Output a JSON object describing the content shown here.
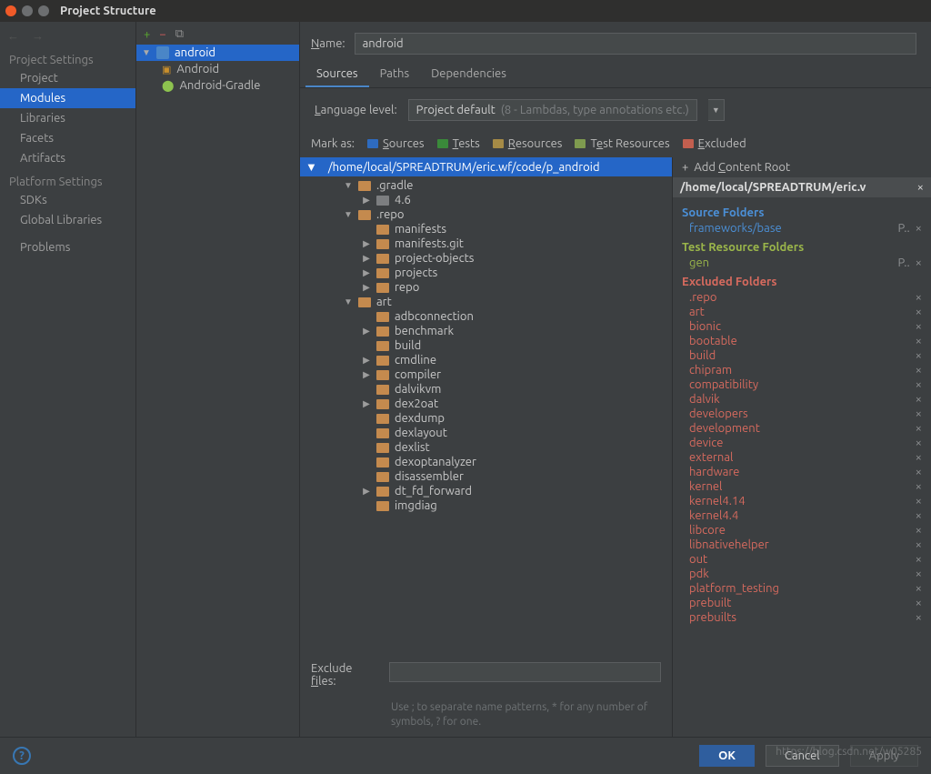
{
  "window": {
    "title": "Project Structure"
  },
  "sidebar": {
    "section1": "Project Settings",
    "items1": [
      "Project",
      "Modules",
      "Libraries",
      "Facets",
      "Artifacts"
    ],
    "section2": "Platform Settings",
    "items2": [
      "SDKs",
      "Global Libraries"
    ],
    "section3": "",
    "items3": [
      "Problems"
    ],
    "selected": "Modules"
  },
  "modules": {
    "root": "android",
    "children": [
      "Android",
      "Android-Gradle"
    ]
  },
  "panel": {
    "name_label": "Name:",
    "name_value": "android",
    "tabs": [
      "Sources",
      "Paths",
      "Dependencies"
    ],
    "active_tab": "Sources",
    "lang_label": "Language level:",
    "lang_value": "Project default",
    "lang_hint": "(8 - Lambdas, type annotations etc.)",
    "mark_label": "Mark as:",
    "marks": [
      "Sources",
      "Tests",
      "Resources",
      "Test Resources",
      "Excluded"
    ]
  },
  "tree": {
    "header": "/home/local/SPREADTRUM/eric.wf/code/p_android",
    "nodes": [
      {
        "d": 1,
        "t": "down",
        "c": "orange",
        "n": ".gradle"
      },
      {
        "d": 2,
        "t": "right",
        "c": "grey",
        "n": "4.6"
      },
      {
        "d": 1,
        "t": "down",
        "c": "orange",
        "n": ".repo"
      },
      {
        "d": 2,
        "t": "none",
        "c": "orange",
        "n": "manifests"
      },
      {
        "d": 2,
        "t": "right",
        "c": "orange",
        "n": "manifests.git"
      },
      {
        "d": 2,
        "t": "right",
        "c": "orange",
        "n": "project-objects"
      },
      {
        "d": 2,
        "t": "right",
        "c": "orange",
        "n": "projects"
      },
      {
        "d": 2,
        "t": "right",
        "c": "orange",
        "n": "repo"
      },
      {
        "d": 1,
        "t": "down",
        "c": "orange",
        "n": "art"
      },
      {
        "d": 2,
        "t": "none",
        "c": "orange",
        "n": "adbconnection"
      },
      {
        "d": 2,
        "t": "right",
        "c": "orange",
        "n": "benchmark"
      },
      {
        "d": 2,
        "t": "none",
        "c": "orange",
        "n": "build"
      },
      {
        "d": 2,
        "t": "right",
        "c": "orange",
        "n": "cmdline"
      },
      {
        "d": 2,
        "t": "right",
        "c": "orange",
        "n": "compiler"
      },
      {
        "d": 2,
        "t": "none",
        "c": "orange",
        "n": "dalvikvm"
      },
      {
        "d": 2,
        "t": "right",
        "c": "orange",
        "n": "dex2oat"
      },
      {
        "d": 2,
        "t": "none",
        "c": "orange",
        "n": "dexdump"
      },
      {
        "d": 2,
        "t": "none",
        "c": "orange",
        "n": "dexlayout"
      },
      {
        "d": 2,
        "t": "none",
        "c": "orange",
        "n": "dexlist"
      },
      {
        "d": 2,
        "t": "none",
        "c": "orange",
        "n": "dexoptanalyzer"
      },
      {
        "d": 2,
        "t": "none",
        "c": "orange",
        "n": "disassembler"
      },
      {
        "d": 2,
        "t": "right",
        "c": "orange",
        "n": "dt_fd_forward"
      },
      {
        "d": 2,
        "t": "none",
        "c": "orange",
        "n": "imgdiag"
      }
    ],
    "exclude_label": "Exclude files:",
    "exclude_hint": "Use ; to separate name patterns, * for any number of symbols, ? for one."
  },
  "roots": {
    "add_label": "Add Content Root",
    "path": "/home/local/SPREADTRUM/eric.v",
    "groups": [
      {
        "title": "Source Folders",
        "cls": "src",
        "items": [
          {
            "n": "frameworks/base",
            "act": "P.."
          }
        ]
      },
      {
        "title": "Test Resource Folders",
        "cls": "tres",
        "items": [
          {
            "n": "gen",
            "act": "P.."
          }
        ]
      },
      {
        "title": "Excluded Folders",
        "cls": "exc",
        "items": [
          {
            "n": ".repo"
          },
          {
            "n": "art"
          },
          {
            "n": "bionic"
          },
          {
            "n": "bootable"
          },
          {
            "n": "build"
          },
          {
            "n": "chipram"
          },
          {
            "n": "compatibility"
          },
          {
            "n": "dalvik"
          },
          {
            "n": "developers"
          },
          {
            "n": "development"
          },
          {
            "n": "device"
          },
          {
            "n": "external"
          },
          {
            "n": "hardware"
          },
          {
            "n": "kernel"
          },
          {
            "n": "kernel4.14"
          },
          {
            "n": "kernel4.4"
          },
          {
            "n": "libcore"
          },
          {
            "n": "libnativehelper"
          },
          {
            "n": "out"
          },
          {
            "n": "pdk"
          },
          {
            "n": "platform_testing"
          },
          {
            "n": "prebuilt"
          },
          {
            "n": "prebuilts"
          }
        ]
      }
    ]
  },
  "buttons": {
    "ok": "OK",
    "cancel": "Cancel",
    "apply": "Apply"
  },
  "watermark": "https://blog.csdn.net/w05285"
}
